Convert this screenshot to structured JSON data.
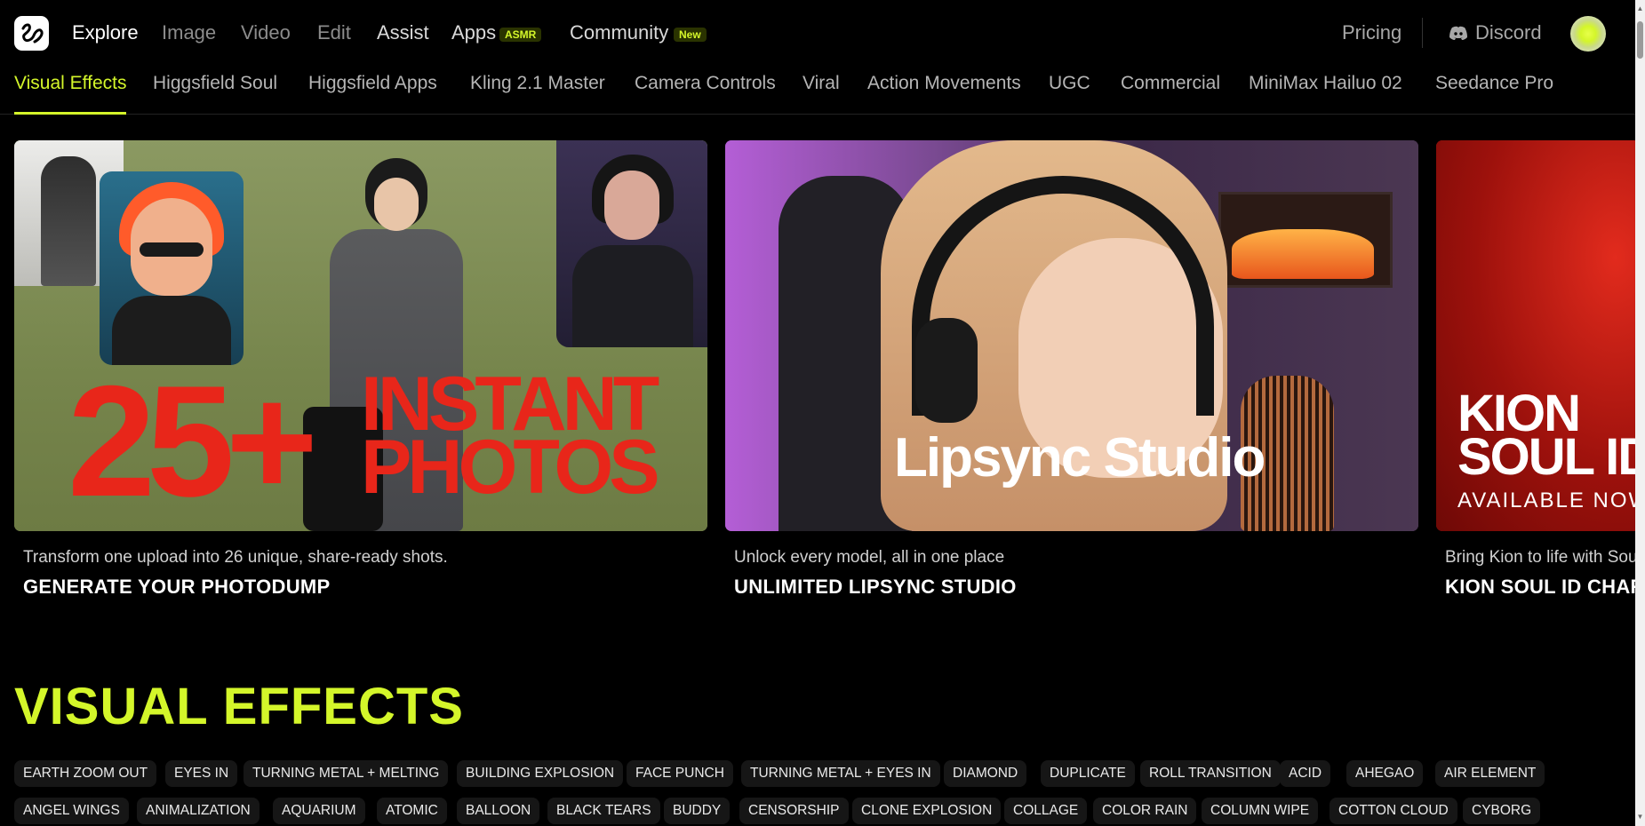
{
  "nav": {
    "items": [
      {
        "label": "Explore",
        "active": true
      },
      {
        "label": "Image"
      },
      {
        "label": "Video"
      },
      {
        "label": "Edit"
      },
      {
        "label": "Assist"
      },
      {
        "label": "Apps",
        "badge": "ASMR"
      },
      {
        "label": "Community",
        "badge": "New"
      }
    ],
    "pricing": "Pricing",
    "discord": "Discord"
  },
  "categories": [
    {
      "label": "Visual Effects",
      "active": true
    },
    {
      "label": "Higgsfield Soul"
    },
    {
      "label": "Higgsfield Apps"
    },
    {
      "label": "Kling 2.1 Master"
    },
    {
      "label": "Camera Controls"
    },
    {
      "label": "Viral"
    },
    {
      "label": "Action Movements"
    },
    {
      "label": "UGC"
    },
    {
      "label": "Commercial"
    },
    {
      "label": "MiniMax Hailuo 02"
    },
    {
      "label": "Seedance Pro"
    }
  ],
  "cards": [
    {
      "art_big": "25+",
      "art_line1": "INSTANT",
      "art_line2": "PHOTOS",
      "subtitle": "Transform one upload into 26 unique, share-ready shots.",
      "title": "GENERATE YOUR PHOTODUMP"
    },
    {
      "art_text": "Lipsync Studio",
      "subtitle": "Unlock every model, all in one place",
      "title": "UNLIMITED LIPSYNC STUDIO"
    },
    {
      "art_line1": "KION",
      "art_line2": "SOUL ID",
      "art_line3": "AVAILABLE NOW",
      "subtitle": "Bring Kion to life with Sou",
      "title": "KION SOUL ID CHARA"
    }
  ],
  "section": {
    "title": "VISUAL EFFECTS",
    "chips_row1": [
      "EARTH ZOOM OUT",
      "EYES IN",
      "TURNING METAL + MELTING",
      "BUILDING EXPLOSION",
      "FACE PUNCH",
      "TURNING METAL + EYES IN",
      "DIAMOND",
      "DUPLICATE",
      "ROLL TRANSITION",
      "ACID",
      "AHEGAO",
      "AIR ELEMENT"
    ],
    "chips_row2": [
      "ANGEL WINGS",
      "ANIMALIZATION",
      "AQUARIUM",
      "ATOMIC",
      "BALLOON",
      "BLACK TEARS",
      "BUDDY",
      "CENSORSHIP",
      "CLONE EXPLOSION",
      "COLLAGE",
      "COLOR RAIN",
      "COLUMN WIPE",
      "COTTON CLOUD",
      "CYBORG"
    ]
  },
  "colors": {
    "accent": "#d4f62a",
    "background": "#000000",
    "poster_red": "#e8261a"
  }
}
